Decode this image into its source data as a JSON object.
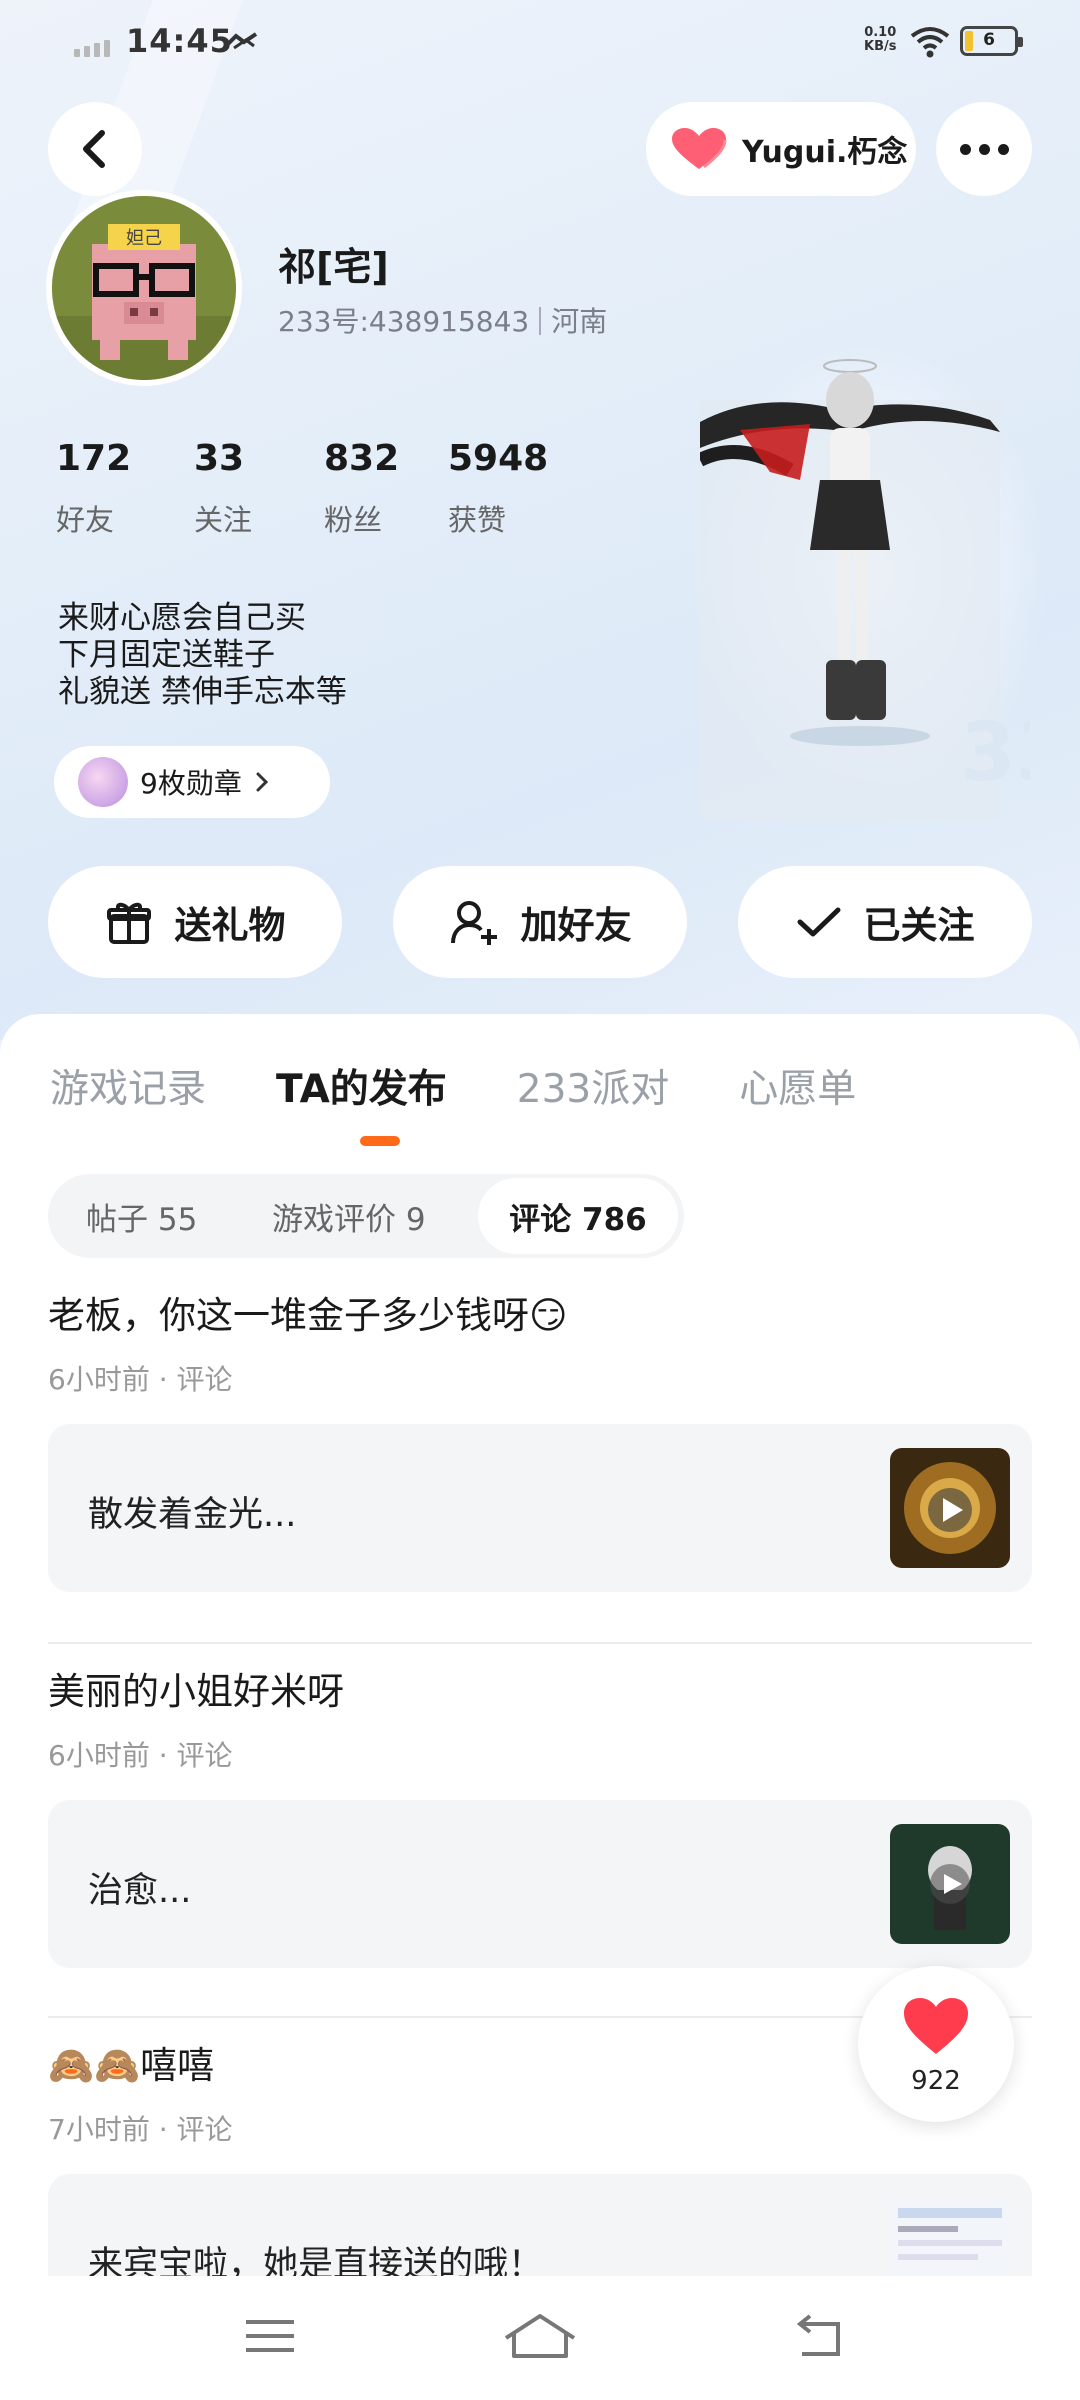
{
  "status_bar": {
    "time": "14:45",
    "net_speed_value": "0.10",
    "net_speed_unit": "KB/s",
    "battery": "6"
  },
  "top_bar": {
    "ip_label": "Yugui.朽念"
  },
  "profile": {
    "name": "祁[宅]",
    "id_line": "233号:438915843",
    "region": "河南",
    "avatar_text": "妲己",
    "stats": [
      {
        "value": "172",
        "label": "好友"
      },
      {
        "value": "33",
        "label": "关注"
      },
      {
        "value": "832",
        "label": "粉丝"
      },
      {
        "value": "5948",
        "label": "获赞"
      }
    ],
    "bio_lines": [
      "来财心愿会自己买",
      "下月固定送鞋子",
      "礼貌送  禁伸手忘本等"
    ],
    "badge_label": "9枚勋章"
  },
  "actions": {
    "gift": "送礼物",
    "add_friend": "加好友",
    "followed": "已关注"
  },
  "tabs": [
    "游戏记录",
    "TA的发布",
    "233派对",
    "心愿单"
  ],
  "subtabs": [
    "帖子 55",
    "游戏评价 9",
    "评论 786"
  ],
  "posts": [
    {
      "title": "老板，你这一堆金子多少钱呀😏",
      "meta": "6小时前 · 评论",
      "quote": "散发着金光..."
    },
    {
      "title": "美丽的小姐好米呀",
      "meta": "6小时前 · 评论",
      "quote": "治愈..."
    },
    {
      "title": "🙈🙈嘻嘻",
      "meta": "7小时前 · 评论",
      "quote": "来宾宝啦，她是直接送的哦！"
    }
  ],
  "like_count": "922",
  "colors": {
    "accent": "#ff6a1a",
    "heart": "#ff3b4e",
    "background": "#e9f1fb"
  }
}
